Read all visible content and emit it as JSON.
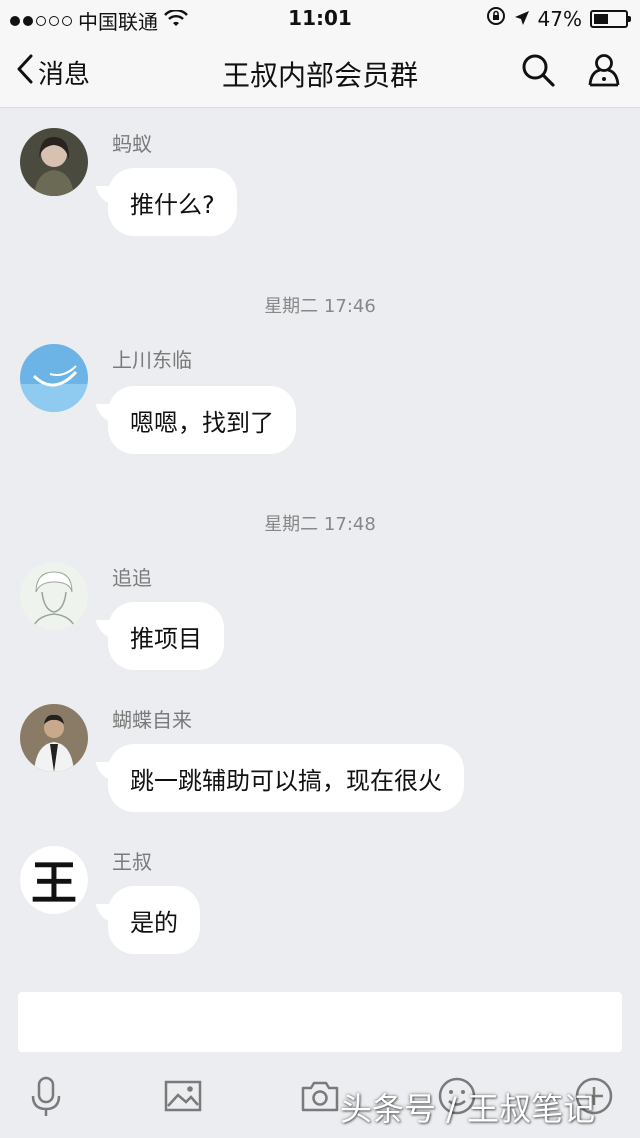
{
  "status_bar": {
    "carrier": "中国联通",
    "time": "11:01",
    "battery": "47%",
    "battery_level": 0.47
  },
  "nav": {
    "back_label": "消息",
    "title": "王叔内部会员群"
  },
  "messages": [
    {
      "sender": "蚂蚁",
      "text": "推什么?"
    },
    {
      "sender": "上川东临",
      "text": "嗯嗯，找到了"
    },
    {
      "sender": "追追",
      "text": "推项目"
    },
    {
      "sender": "蝴蝶自来",
      "text": "跳一跳辅助可以搞，现在很火"
    },
    {
      "sender": "王叔",
      "text": "是的"
    }
  ],
  "timestamps": [
    "星期二 17:46",
    "星期二 17:48"
  ],
  "avatar_letter": "王",
  "input": {
    "value": ""
  },
  "watermark": "头条号 / 王叔笔记",
  "icons": [
    "wifi-icon",
    "lock-rotation-icon",
    "location-arrow-icon",
    "back-chevron-icon",
    "search-icon",
    "group-members-icon",
    "microphone-icon",
    "image-icon",
    "camera-icon",
    "emoji-icon",
    "plus-icon"
  ]
}
